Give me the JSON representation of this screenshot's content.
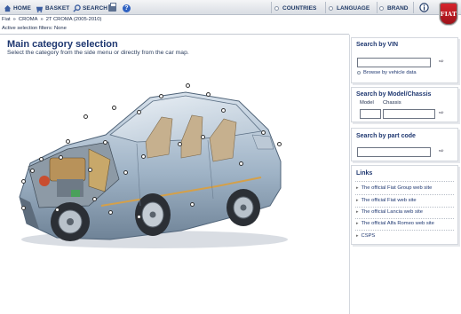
{
  "toolbar": {
    "home": "HOME",
    "basket": "BASKET",
    "search": "SEARCH",
    "countries": "COUNTRIES",
    "language": "LANGUAGE",
    "brand": "BRAND"
  },
  "brand_logo": "FIAT",
  "breadcrumb": [
    "Fiat",
    "»",
    "CROMA",
    "»",
    "2T CROMA (2005-2010)"
  ],
  "active_filters": "Active selection filters: None",
  "main": {
    "title": "Main category selection",
    "subtitle": "Select the category from the side menu or directly from the car map."
  },
  "vin_panel": {
    "title": "Search by VIN",
    "input_value": "",
    "go": "⇨",
    "browse_link": "Browse by vehicle data"
  },
  "model_panel": {
    "title": "Search by Model/Chassis",
    "model_label": "Model",
    "chassis_label": "Chassis",
    "model_value": "",
    "chassis_value": "",
    "go": "⇨"
  },
  "partcode_panel": {
    "title": "Search by part code",
    "input_value": "",
    "go": "⇨"
  },
  "links_panel": {
    "title": "Links",
    "items": [
      "The official Fiat Group web site",
      "The official Fiat web site",
      "The official Lancia web site",
      "The official Alfa Romeo web site",
      "CSPS"
    ]
  },
  "colors": {
    "accent": "#1e3770",
    "brand": "#c41a22",
    "car_body": "#a9b9c9"
  }
}
